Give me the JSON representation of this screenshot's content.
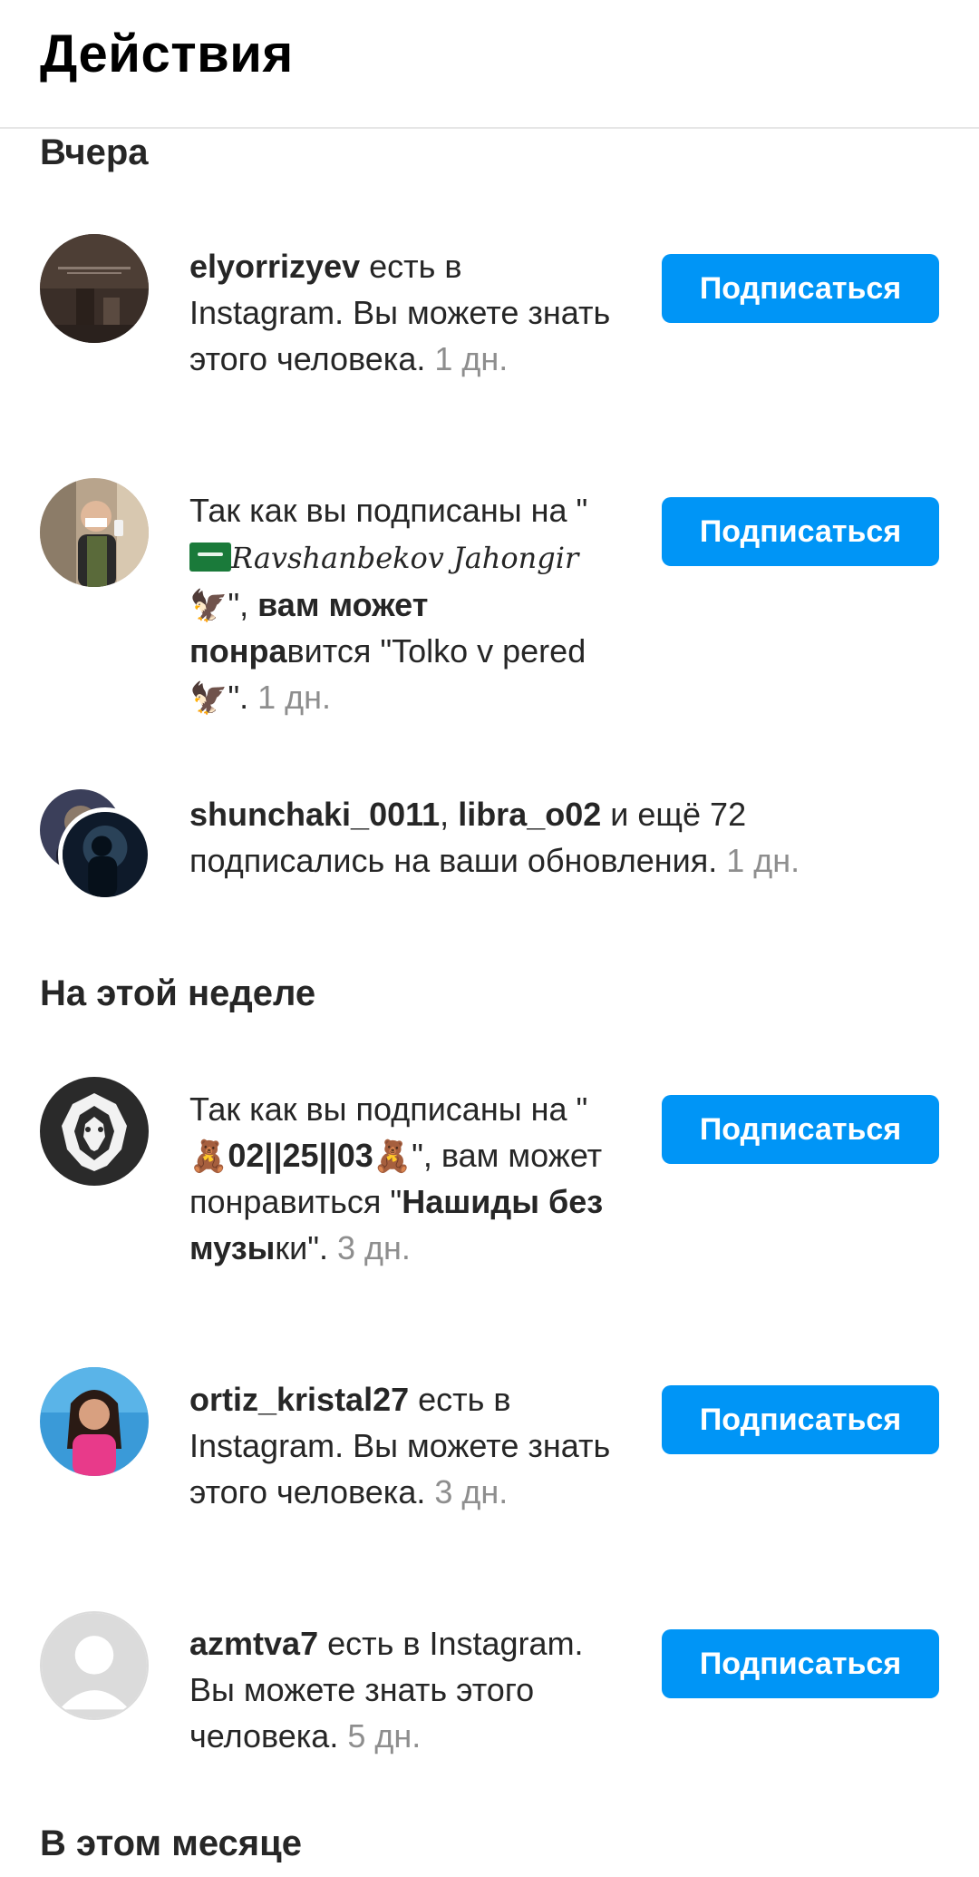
{
  "header": {
    "title": "Действия"
  },
  "sections": {
    "yesterday": "Вчера",
    "this_week": "На этой неделе",
    "this_month": "В этом месяце"
  },
  "follow_label": "Подписаться",
  "n1": {
    "username": "elyorrizyev",
    "text": " есть в Instagram. Вы можете знать этого человека. ",
    "time": "1 дн."
  },
  "n2": {
    "prefix": "Так как вы подписаны на \"",
    "name_a": "Ravshanbekov",
    "name_b": "Jahongir",
    "eagle": "🦅",
    "suffix_quote": "\", ",
    "bold_a": "вам может",
    "bold_b": "понра",
    "middle": "вится \"Tolko v pered ",
    "end": "\". ",
    "time": "1 дн."
  },
  "n3": {
    "user1": "shunchaki_0011",
    "sep": ", ",
    "user2": "libra_o02",
    "text": " и ещё 72 подписались на ваши обновления. ",
    "time": "1 дн."
  },
  "n4": {
    "prefix": "Так как вы подписаны на \"",
    "bear": "🧸",
    "name": "02||25||03",
    "after": "\", вам может понравиться \"",
    "bold": "Нашиды без музы",
    "tail": "ки\". ",
    "time": "3 дн."
  },
  "n5": {
    "username": "ortiz_kristal27",
    "text": " есть в Instagram. Вы можете знать этого человека. ",
    "time": "3 дн."
  },
  "n6": {
    "username": "azmtva7",
    "text": " есть в Instagram. Вы можете знать этого человека. ",
    "time": "5 дн."
  },
  "colors": {
    "accent": "#0095f6",
    "muted": "#8e8e8e",
    "text": "#262626"
  }
}
